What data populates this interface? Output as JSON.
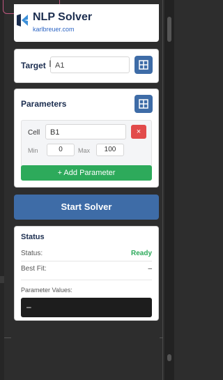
{
  "header": {
    "title": "NLP Solver",
    "link": "karlbreuer.com"
  },
  "target": {
    "label": "Target",
    "value": "A1"
  },
  "parameters": {
    "title": "Parameters",
    "items": [
      {
        "cell_label": "Cell",
        "cell_value": "B1",
        "remove_label": "×",
        "min_label": "Min",
        "min_value": "0",
        "max_label": "Max",
        "max_value": "100"
      }
    ],
    "add_label": "+ Add Parameter"
  },
  "start_label": "Start Solver",
  "status": {
    "title": "Status",
    "status_label": "Status:",
    "status_value": "Ready",
    "bestfit_label": "Best Fit:",
    "bestfit_value": "–",
    "param_values_label": "Parameter Values:",
    "param_values_value": "–"
  },
  "colors": {
    "primary": "#3e6ca7",
    "success": "#2daa5b",
    "danger": "#e24b4b",
    "title": "#1b2d4f"
  },
  "icons": {
    "select_range": "grid-icon",
    "remove": "close-icon",
    "logo": "solver-logo"
  }
}
